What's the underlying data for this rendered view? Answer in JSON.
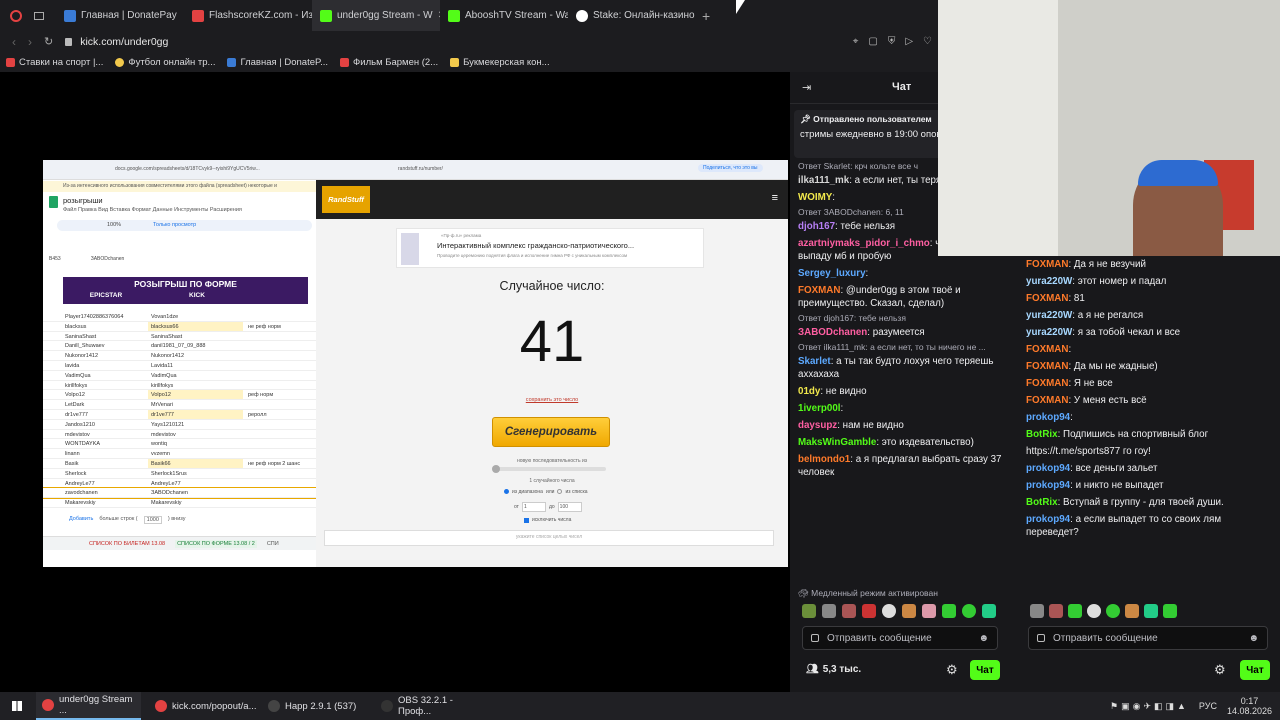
{
  "browser": {
    "tabs": [
      {
        "label": "Главная | DonatePay",
        "color": "#3a7bd5"
      },
      {
        "label": "FlashscoreKZ.com - Избр",
        "color": "#e34242"
      },
      {
        "label": "under0gg Stream - W",
        "color": "#53fc18",
        "active": true
      },
      {
        "label": "AbooshTV Stream - Watch",
        "color": "#53fc18"
      },
      {
        "label": "Stake: Онлайн-казино и сп",
        "color": "#ffffff"
      }
    ],
    "url": "kick.com/under0gg",
    "bookmarks": [
      {
        "label": "Ставки на спорт |...",
        "color": "#e34242"
      },
      {
        "label": "Футбол онлайн тр...",
        "color": "#f2c94c"
      },
      {
        "label": "Главная | DonateP...",
        "color": "#3a7bd5"
      },
      {
        "label": "Фильм Бармен (2...",
        "color": "#e34242"
      },
      {
        "label": "Букмекерская кон...",
        "color": "#f2c94c"
      }
    ]
  },
  "sheet": {
    "url": "docs.google.com/spreadsheets/d/18TCvyk9--ryishi9YgUCV5riw...",
    "warning": "Из-за интенсивного использования совместителями этого файла (spreadsheet) некоторые и",
    "doc_title": "розыгрыши",
    "menu": "Файл  Правка  Вид  Вставка  Формат  Данные  Инструменты  Расширения",
    "zoom": "100%",
    "view_only": "Только просмотр",
    "cellref": "B453",
    "fx": "ЗABODchanen",
    "banner": "РОЗЫГРЫШ ПО ФОРМЕ",
    "col1": "EPICSTAR",
    "col2": "KICK",
    "rows": [
      [
        "Player17402886376064",
        "Vovan1dze",
        ""
      ],
      [
        "blacksus",
        "blacksus66",
        "не реф норм"
      ],
      [
        "SaninaShast",
        "SaninaShast",
        ""
      ],
      [
        "Danill_Shuwaev",
        "danil1981_07_09_888",
        ""
      ],
      [
        "Nukonor1412",
        "Nukonor1412",
        ""
      ],
      [
        "lavida",
        "Lavida11",
        ""
      ],
      [
        "VadimQua",
        "VadimQua",
        ""
      ],
      [
        "kirillfokys",
        "kirillfokys",
        ""
      ],
      [
        "Volpo12",
        "Volpo12",
        "реф норм"
      ],
      [
        "LetDark",
        "MrVenari",
        ""
      ],
      [
        "dr1ve777",
        "dr1ve777",
        "реролл"
      ],
      [
        "Jandos1210",
        "Yays1210121",
        ""
      ],
      [
        "mdevistov",
        "mdevistov",
        ""
      ],
      [
        "WONTDAYKA",
        "wontiq",
        ""
      ],
      [
        "linann",
        "vvzemn",
        ""
      ],
      [
        "Basik",
        "Basik66",
        "не реф норм 2 шанс"
      ],
      [
        "Sherlock",
        "Sherlock1Srus",
        ""
      ],
      [
        "AndreyLe77",
        "AndreyLe77",
        ""
      ],
      [
        "zavodchanen",
        "ЗABODchanen",
        ""
      ],
      [
        "Makarevskiy",
        "Makarevskiy",
        ""
      ]
    ],
    "add_label": "Добавить",
    "more_rows": "больше строк (",
    "rows_count": "1000",
    "below": ") внизу",
    "sheet_tab1": "СПИСОК ПО БИЛЕТАМ 13.08",
    "sheet_tab2": "СПИСОК ПО ФОРМЕ 13.08 / 2",
    "sheet_tab3": "СПИ"
  },
  "randstuff": {
    "url": "randstuff.ru/number/",
    "logo": "RandStuff",
    "ad_source": "«Пр-ф.ru» реклама",
    "ad_title": "Интерактивный комплекс гражданско-патриотического...",
    "ad_sub": "Проводите церемонию поднятия флага и исполнение гимна РФ с уникальным комплексом",
    "heading": "Случайное число:",
    "number": "41",
    "save_link": "сохранить это число",
    "generate": "Сгенерировать",
    "seq_label": "новую последовательность из",
    "count_label": "1 случайного числа",
    "range_opt": "из диапазона",
    "or": "или",
    "list_opt": "из списка",
    "from": "от",
    "from_val": "1",
    "to": "до",
    "to_val": "100",
    "exclude": "исключить числа",
    "hint": "укажите список целых чисел",
    "share": "Поделиться, что это вы"
  },
  "chat": {
    "title": "Чат",
    "pinned_label": "Отправлено пользователем",
    "pinned_text": "стримы ежедневно в 19:00 оповещения в тг:...",
    "messages": [
      {
        "reply": "Ответ Skarlet: крч кольте все ч"
      },
      {
        "nick": "ilka111_mk",
        "color": "#d6d6d6",
        "text": "а если нет, ты теряешь"
      },
      {
        "nick": "WOIMY",
        "color": "#f2e94c",
        "text": ""
      },
      {
        "reply": "Ответ ЗABODchanen: 6, 11"
      },
      {
        "nick": "djoh167",
        "color": "#b77ff5",
        "text": "тебе нельзя"
      },
      {
        "nick": "azartniymaks_pidor_i_chmo",
        "color": "#ff5fa2",
        "text": "через год выпаду мб и пробую"
      },
      {
        "nick": "Sergey_luxury",
        "color": "#5da9ff",
        "text": ""
      },
      {
        "nick": "FOXMAN",
        "color": "#ff7a2a",
        "text": "@under0gg в этом твоё и преимущество. Сказал, сделал)"
      },
      {
        "reply": "Ответ djoh167: тебе нельзя"
      },
      {
        "nick": "ЗABODchanen",
        "color": "#ff5fa2",
        "text": "разумеется"
      },
      {
        "reply": "Ответ ilka111_mk: а если нет, то ты ничего не ..."
      },
      {
        "nick": "Skarlet",
        "color": "#5da9ff",
        "text": "а ты так будто лохуя чего теряешь аххахаха"
      },
      {
        "nick": "01dy",
        "color": "#f2e94c",
        "text": "не видно"
      },
      {
        "nick": "1iverp00l",
        "color": "#53fc18",
        "text": ""
      },
      {
        "nick": "daysupz",
        "color": "#ff5fa2",
        "text": "нам не видно"
      },
      {
        "nick": "MaksWinGamble",
        "color": "#53fc18",
        "text": "это издевательство)"
      },
      {
        "nick": "belmondo1",
        "color": "#ff7a2a",
        "text": "а я предлагал выбрать сразу 37 человек"
      }
    ],
    "slow_mode": "Медленный режим активирован",
    "input_placeholder": "Отправить сообщение",
    "viewers": "5,3 тыс.",
    "chat_button": "Чат"
  },
  "chat2": {
    "messages": [
      {
        "nick": "FOXMAN",
        "color": "#ff7a2a",
        "text": "Да я не везучий"
      },
      {
        "nick": "yura220W",
        "color": "#a8d8ff",
        "text": "этот номер и падал"
      },
      {
        "nick": "FOXMAN",
        "color": "#ff7a2a",
        "text": "81"
      },
      {
        "nick": "yura220W",
        "color": "#a8d8ff",
        "text": "а я не регался"
      },
      {
        "nick": "yura220W",
        "color": "#a8d8ff",
        "text": "я за тобой чекал и все"
      },
      {
        "nick": "FOXMAN",
        "color": "#ff7a2a",
        "text": ""
      },
      {
        "nick": "FOXMAN",
        "color": "#ff7a2a",
        "text": "Да мы не жадные)"
      },
      {
        "nick": "FOXMAN",
        "color": "#ff7a2a",
        "text": "Я не все"
      },
      {
        "nick": "FOXMAN",
        "color": "#ff7a2a",
        "text": "У меня есть всё"
      },
      {
        "nick": "prokop94",
        "color": "#5da9ff",
        "text": ""
      },
      {
        "nick": "BotRix",
        "color": "#53fc18",
        "text": "Подпишись на спортивный блог"
      },
      {
        "nick": "",
        "color": "#5da9ff",
        "text": "https://t.me/sports877 го гоу!"
      },
      {
        "nick": "prokop94",
        "color": "#5da9ff",
        "text": "все деньги зальет"
      },
      {
        "nick": "prokop94",
        "color": "#5da9ff",
        "text": "и никто не выпадет"
      },
      {
        "nick": "BotRix",
        "color": "#53fc18",
        "text": "Вступай в группу - для твоей души."
      },
      {
        "nick": "prokop94",
        "color": "#5da9ff",
        "text": "а если выпадет то со своих лям переведет?"
      }
    ],
    "input_placeholder": "Отправить сообщение",
    "chat_button": "Чат"
  },
  "taskbar": {
    "items": [
      {
        "label": "under0gg Stream ...",
        "color": "#e34242",
        "active": true
      },
      {
        "label": "kick.com/popout/a...",
        "color": "#e34242"
      },
      {
        "label": "Нарр 2.9.1 (537)",
        "color": "#444"
      },
      {
        "label": "OBS 32.2.1 - Проф...",
        "color": "#333"
      }
    ],
    "lang": "РУС",
    "time": "0:17",
    "date": "14.08.2026"
  }
}
